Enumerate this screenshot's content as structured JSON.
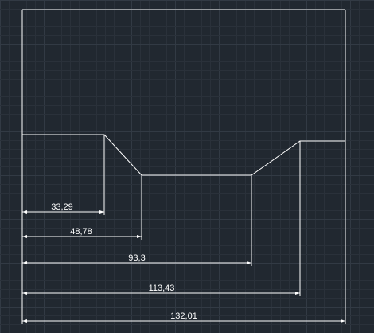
{
  "colors": {
    "background": "#212830",
    "grid_minor": "#2a313a",
    "grid_major": "#323a44",
    "geometry": "#ffffff",
    "dimension": "#ffffff"
  },
  "dimensions": [
    {
      "value": 33.29,
      "label": "33,29"
    },
    {
      "value": 48.78,
      "label": "48,78"
    },
    {
      "value": 93.3,
      "label": "93,3"
    },
    {
      "value": 113.43,
      "label": "113,43"
    },
    {
      "value": 132.01,
      "label": "132,01"
    }
  ]
}
